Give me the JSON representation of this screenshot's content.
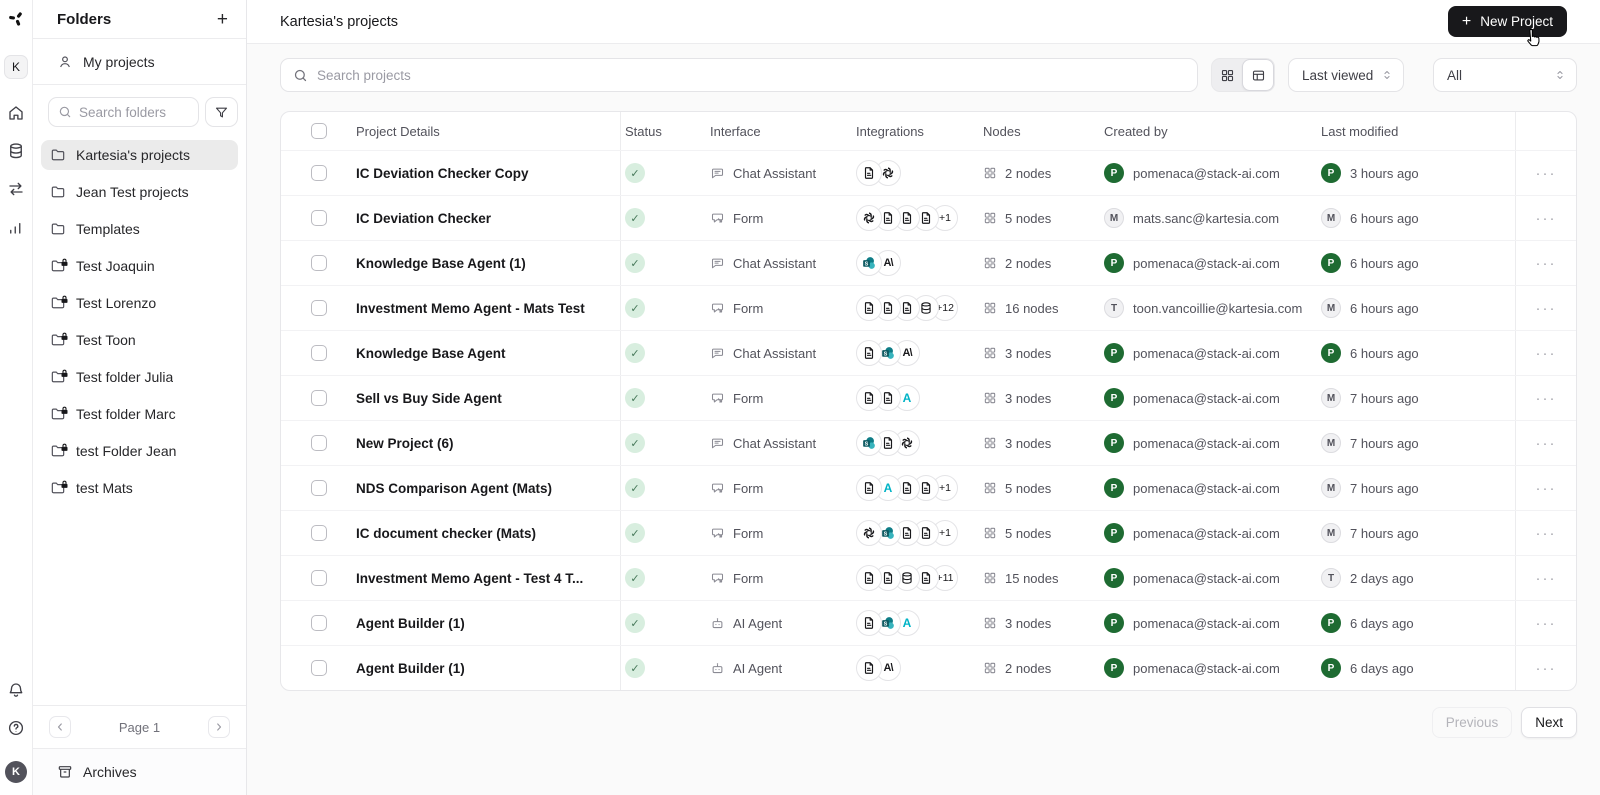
{
  "rail": {
    "avatar_top": "K",
    "avatar_bottom": "K"
  },
  "sidebar": {
    "title": "Folders",
    "my_projects_label": "My projects",
    "search_placeholder": "Search folders",
    "folders": [
      {
        "label": "Kartesia's projects",
        "locked": false,
        "selected": true
      },
      {
        "label": "Jean Test projects",
        "locked": false,
        "selected": false
      },
      {
        "label": "Templates",
        "locked": false,
        "selected": false
      },
      {
        "label": "Test Joaquin",
        "locked": true,
        "selected": false
      },
      {
        "label": "Test Lorenzo",
        "locked": true,
        "selected": false
      },
      {
        "label": "Test Toon",
        "locked": true,
        "selected": false
      },
      {
        "label": "Test folder Julia",
        "locked": true,
        "selected": false
      },
      {
        "label": "Test folder Marc",
        "locked": true,
        "selected": false
      },
      {
        "label": "test Folder Jean",
        "locked": true,
        "selected": false
      },
      {
        "label": "test Mats",
        "locked": true,
        "selected": false
      }
    ],
    "page_label": "Page 1",
    "archives_label": "Archives"
  },
  "header": {
    "title": "Kartesia's projects",
    "new_project_label": "New Project"
  },
  "controls": {
    "search_placeholder": "Search projects",
    "sort_value": "Last viewed",
    "scope_value": "All"
  },
  "table": {
    "columns": [
      "Project Details",
      "Status",
      "Interface",
      "Integrations",
      "Nodes",
      "Created by",
      "Last modified"
    ],
    "rows": [
      {
        "name": "IC Deviation Checker Copy",
        "status": "active",
        "interface_type": "chat",
        "interface_label": "Chat Assistant",
        "integrations": [
          "doc",
          "openai"
        ],
        "integrations_extra": null,
        "nodes": "2 nodes",
        "created_initial": "P",
        "created_color": "green",
        "created_email": "pomenaca@stack-ai.com",
        "modified_initial": "P",
        "modified_color": "green",
        "modified_text": "3 hours ago"
      },
      {
        "name": "IC Deviation Checker",
        "status": "active",
        "interface_type": "form",
        "interface_label": "Form",
        "integrations": [
          "openai",
          "doc",
          "doc",
          "doc"
        ],
        "integrations_extra": "+1",
        "nodes": "5 nodes",
        "created_initial": "M",
        "created_color": "gray",
        "created_email": "mats.sanc@kartesia.com",
        "modified_initial": "M",
        "modified_color": "gray",
        "modified_text": "6 hours ago"
      },
      {
        "name": "Knowledge Base Agent (1)",
        "status": "active",
        "interface_type": "chat",
        "interface_label": "Chat Assistant",
        "integrations": [
          "sharepoint",
          "anthropic"
        ],
        "integrations_extra": null,
        "nodes": "2 nodes",
        "created_initial": "P",
        "created_color": "green",
        "created_email": "pomenaca@stack-ai.com",
        "modified_initial": "P",
        "modified_color": "green",
        "modified_text": "6 hours ago"
      },
      {
        "name": "Investment Memo Agent - Mats Test",
        "status": "active",
        "interface_type": "form",
        "interface_label": "Form",
        "integrations": [
          "doc",
          "doc",
          "doc",
          "db"
        ],
        "integrations_extra": "+12",
        "nodes": "16 nodes",
        "created_initial": "T",
        "created_color": "gray",
        "created_email": "toon.vancoillie@kartesia.com",
        "modified_initial": "M",
        "modified_color": "gray",
        "modified_text": "6 hours ago"
      },
      {
        "name": "Knowledge Base Agent",
        "status": "active",
        "interface_type": "chat",
        "interface_label": "Chat Assistant",
        "integrations": [
          "doc",
          "sharepoint",
          "anthropic"
        ],
        "integrations_extra": null,
        "nodes": "3 nodes",
        "created_initial": "P",
        "created_color": "green",
        "created_email": "pomenaca@stack-ai.com",
        "modified_initial": "P",
        "modified_color": "green",
        "modified_text": "6 hours ago"
      },
      {
        "name": "Sell vs Buy Side Agent",
        "status": "active",
        "interface_type": "form",
        "interface_label": "Form",
        "integrations": [
          "doc",
          "doc",
          "acyan"
        ],
        "integrations_extra": null,
        "nodes": "3 nodes",
        "created_initial": "P",
        "created_color": "green",
        "created_email": "pomenaca@stack-ai.com",
        "modified_initial": "M",
        "modified_color": "gray",
        "modified_text": "7 hours ago"
      },
      {
        "name": "New Project (6)",
        "status": "active",
        "interface_type": "chat",
        "interface_label": "Chat Assistant",
        "integrations": [
          "sharepoint",
          "doc",
          "openai"
        ],
        "integrations_extra": null,
        "nodes": "3 nodes",
        "created_initial": "P",
        "created_color": "green",
        "created_email": "pomenaca@stack-ai.com",
        "modified_initial": "M",
        "modified_color": "gray",
        "modified_text": "7 hours ago"
      },
      {
        "name": "NDS Comparison Agent (Mats)",
        "status": "active",
        "interface_type": "form",
        "interface_label": "Form",
        "integrations": [
          "doc",
          "acyan",
          "doc",
          "doc"
        ],
        "integrations_extra": "+1",
        "nodes": "5 nodes",
        "created_initial": "P",
        "created_color": "green",
        "created_email": "pomenaca@stack-ai.com",
        "modified_initial": "M",
        "modified_color": "gray",
        "modified_text": "7 hours ago"
      },
      {
        "name": "IC document checker (Mats)",
        "status": "active",
        "interface_type": "form",
        "interface_label": "Form",
        "integrations": [
          "openai",
          "sharepoint",
          "doc",
          "doc"
        ],
        "integrations_extra": "+1",
        "nodes": "5 nodes",
        "created_initial": "P",
        "created_color": "green",
        "created_email": "pomenaca@stack-ai.com",
        "modified_initial": "M",
        "modified_color": "gray",
        "modified_text": "7 hours ago"
      },
      {
        "name": "Investment Memo Agent - Test 4 T...",
        "status": "active",
        "interface_type": "form",
        "interface_label": "Form",
        "integrations": [
          "doc",
          "doc",
          "db",
          "doc"
        ],
        "integrations_extra": "+11",
        "nodes": "15 nodes",
        "created_initial": "P",
        "created_color": "green",
        "created_email": "pomenaca@stack-ai.com",
        "modified_initial": "T",
        "modified_color": "gray",
        "modified_text": "2 days ago"
      },
      {
        "name": "Agent Builder (1)",
        "status": "active",
        "interface_type": "agent",
        "interface_label": "AI Agent",
        "integrations": [
          "doc",
          "sharepoint",
          "acyan"
        ],
        "integrations_extra": null,
        "nodes": "3 nodes",
        "created_initial": "P",
        "created_color": "green",
        "created_email": "pomenaca@stack-ai.com",
        "modified_initial": "P",
        "modified_color": "green",
        "modified_text": "6 days ago"
      },
      {
        "name": "Agent Builder (1)",
        "status": "active",
        "interface_type": "agent",
        "interface_label": "AI Agent",
        "integrations": [
          "doc",
          "anthropic"
        ],
        "integrations_extra": null,
        "nodes": "2 nodes",
        "created_initial": "P",
        "created_color": "green",
        "created_email": "pomenaca@stack-ai.com",
        "modified_initial": "P",
        "modified_color": "green",
        "modified_text": "6 days ago"
      }
    ]
  },
  "pager": {
    "previous_label": "Previous",
    "next_label": "Next"
  },
  "colors": {
    "accent_dark": "#18181b",
    "status_green_bg": "#d8eedf",
    "status_green_check": "#47795a",
    "avatar_green": "#1e6b32",
    "avatar_gray_bg": "#f1f1f3",
    "avatar_gray_text": "#52525b",
    "sharepoint_teal": "#0e7c86",
    "integration_a_cyan": "#00b3c6"
  }
}
